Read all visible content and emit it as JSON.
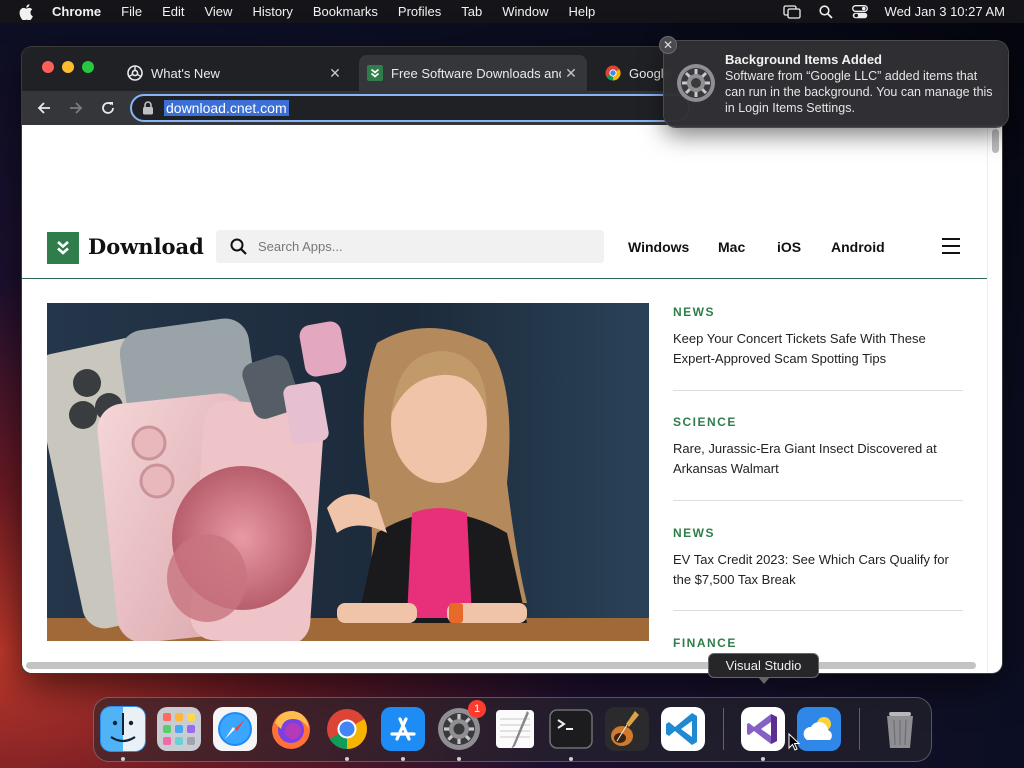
{
  "menubar": {
    "app_name": "Chrome",
    "menus": [
      "File",
      "Edit",
      "View",
      "History",
      "Bookmarks",
      "Profiles",
      "Tab",
      "Window",
      "Help"
    ],
    "clock": "Wed Jan 3  10:27 AM",
    "status_icons": [
      "screen-mirroring-icon",
      "spotlight-search-icon",
      "control-center-icon"
    ]
  },
  "browser": {
    "tabs": [
      {
        "title": "What's New",
        "favicon": "chrome-info-icon"
      },
      {
        "title": "Free Software Downloads and Reviews",
        "favicon": "download-favicon",
        "active": true
      },
      {
        "title": "Google",
        "favicon": "google-chrome-favicon"
      }
    ],
    "url": "download.cnet.com"
  },
  "site": {
    "logo_text": "Download",
    "search_placeholder": "Search Apps...",
    "nav": [
      "Windows",
      "Mac",
      "iOS",
      "Android"
    ],
    "articles": [
      {
        "category": "NEWS",
        "headline": "Keep Your Concert Tickets Safe With These Expert-Approved Scam Spotting Tips"
      },
      {
        "category": "SCIENCE",
        "headline": "Rare, Jurassic-Era Giant Insect Discovered at Arkansas Walmart"
      },
      {
        "category": "NEWS",
        "headline": "EV Tax Credit 2023: See Which Cars Qualify for the $7,500 Tax Break"
      },
      {
        "category": "FINANCE",
        "headline": ""
      }
    ]
  },
  "notification": {
    "title": "Background Items Added",
    "body": "Software from “Google LLC” added items that can run in the background. You can manage this in Login Items Settings."
  },
  "tooltip": "Visual Studio",
  "dock": {
    "apps": [
      "Finder",
      "Launchpad",
      "Safari",
      "Firefox",
      "Google Chrome",
      "App Store",
      "System Settings",
      "TextEdit",
      "Terminal",
      "GarageBand",
      "Visual Studio Code",
      "Visual Studio",
      "Weather",
      "Trash"
    ],
    "system_settings_badge": "1"
  }
}
